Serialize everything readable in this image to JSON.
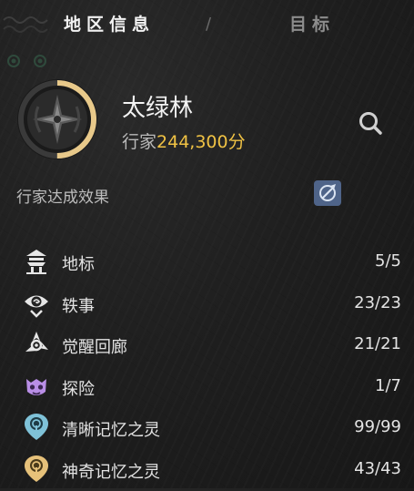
{
  "tabs": {
    "region_info": "地区信息",
    "separator": "/",
    "goals": "目标"
  },
  "region": {
    "name": "太绿林",
    "rank_prefix": "行家",
    "score": "244,300分",
    "progress": 0.5
  },
  "effect": {
    "label": "行家达成效果"
  },
  "stats": [
    {
      "icon": "landmark-icon",
      "label": "地标",
      "value": "5/5"
    },
    {
      "icon": "anecdote-icon",
      "label": "轶事",
      "value": "23/23"
    },
    {
      "icon": "awakening-corridor-icon",
      "label": "觉醒回廊",
      "value": "21/21"
    },
    {
      "icon": "exploration-icon",
      "label": "探险",
      "value": "1/7"
    },
    {
      "icon": "clear-memory-spirit-icon",
      "label": "清晰记忆之灵",
      "value": "99/99"
    },
    {
      "icon": "mystic-memory-spirit-icon",
      "label": "神奇记忆之灵",
      "value": "43/43"
    }
  ],
  "colors": {
    "score": "#f0c244",
    "progress_ring": "#e8c98a",
    "effect_badge": "#4f6489",
    "clear_spirit": "#7fc2d8",
    "mystic_spirit": "#e6c17a",
    "exploration": "#b98ee6"
  }
}
